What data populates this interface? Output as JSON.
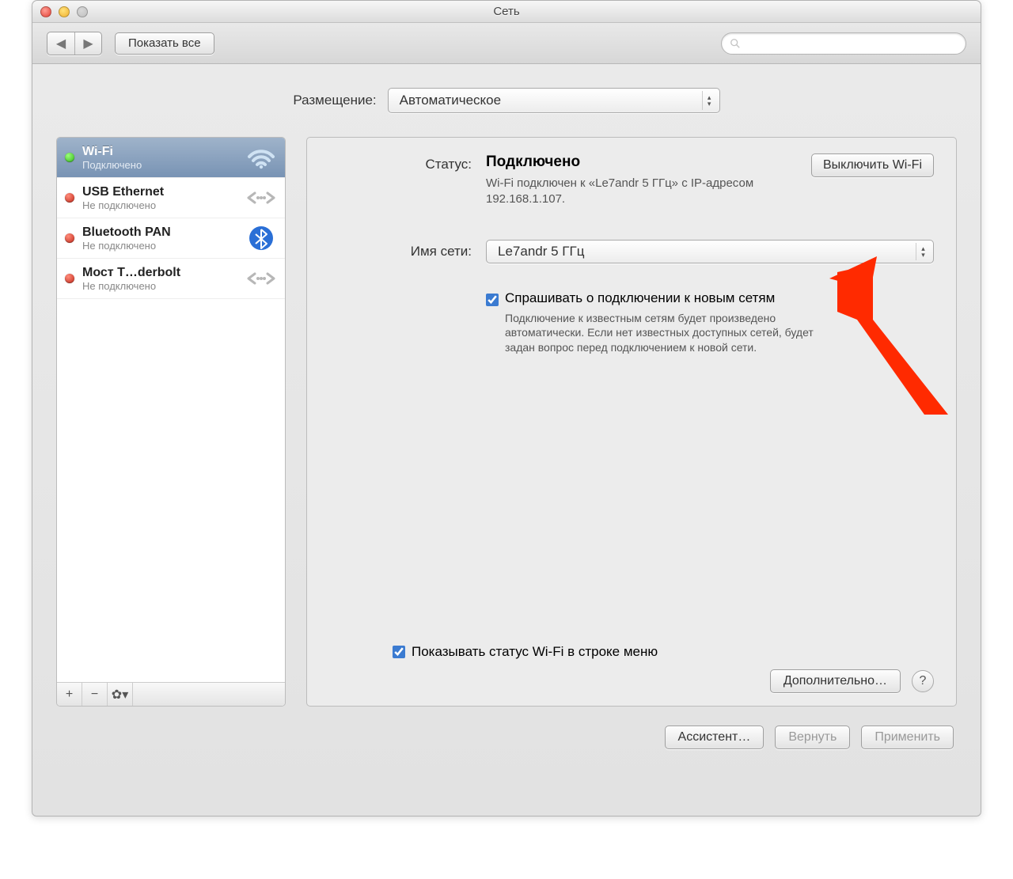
{
  "window": {
    "title": "Сеть"
  },
  "toolbar": {
    "show_all": "Показать все",
    "search_placeholder": ""
  },
  "location": {
    "label": "Размещение:",
    "value": "Автоматическое"
  },
  "services": [
    {
      "name": "Wi-Fi",
      "status": "Подключено",
      "dot": "green",
      "icon": "wifi",
      "selected": true
    },
    {
      "name": "USB Ethernet",
      "status": "Не подключено",
      "dot": "red",
      "icon": "ethernet",
      "selected": false
    },
    {
      "name": "Bluetooth PAN",
      "status": "Не подключено",
      "dot": "red",
      "icon": "bluetooth",
      "selected": false
    },
    {
      "name": "Мост T…derbolt",
      "status": "Не подключено",
      "dot": "red",
      "icon": "ethernet",
      "selected": false
    }
  ],
  "detail": {
    "status_label": "Статус:",
    "status_value": "Подключено",
    "toggle_wifi_btn": "Выключить Wi-Fi",
    "status_desc": "Wi-Fi подключен к «Le7andr 5 ГГц» с IP-адресом 192.168.1.107.",
    "network_label": "Имя сети:",
    "network_value": "Le7andr 5 ГГц",
    "ask_join_label": "Спрашивать о подключении к новым сетям",
    "ask_join_help": "Подключение к известным сетям будет произведено автоматически. Если нет известных доступных сетей, будет задан вопрос перед подключением к новой сети.",
    "show_menu_label": "Показывать статус Wi-Fi в строке меню",
    "advanced_btn": "Дополнительно…"
  },
  "footer": {
    "assist_btn": "Ассистент…",
    "revert_btn": "Вернуть",
    "apply_btn": "Применить"
  }
}
